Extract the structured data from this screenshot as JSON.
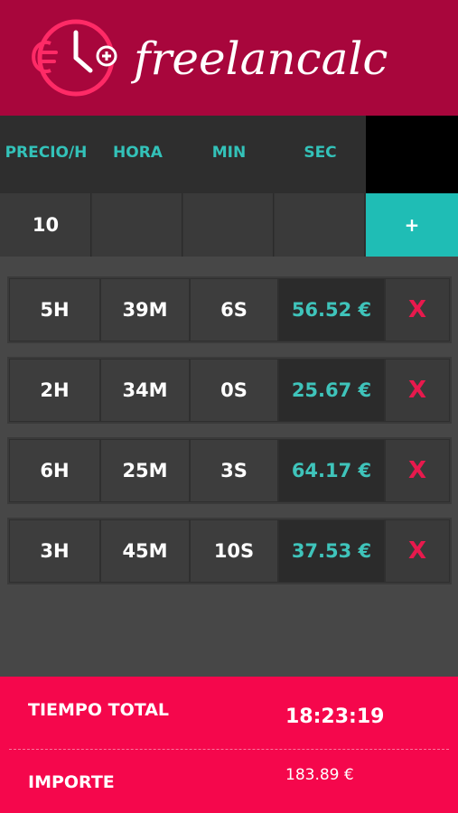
{
  "brand": {
    "name": "freelancalc",
    "color": "#a8063c"
  },
  "columns": [
    "PRECIO/H",
    "HORA",
    "MIN",
    "SEC"
  ],
  "input": {
    "price": "10",
    "hour": "",
    "min": "",
    "sec": "",
    "add_label": "+"
  },
  "entries": [
    {
      "hours": "5H",
      "minutes": "39M",
      "seconds": "6S",
      "amount": "56.52 €",
      "delete": "X"
    },
    {
      "hours": "2H",
      "minutes": "34M",
      "seconds": "0S",
      "amount": "25.67 €",
      "delete": "X"
    },
    {
      "hours": "6H",
      "minutes": "25M",
      "seconds": "3S",
      "amount": "64.17 €",
      "delete": "X"
    },
    {
      "hours": "3H",
      "minutes": "45M",
      "seconds": "10S",
      "amount": "37.53 €",
      "delete": "X"
    }
  ],
  "footer": {
    "total_time_label": "TIEMPO TOTAL",
    "total_time_value": "18:23:19",
    "amount_label": "IMPORTE",
    "amount_value": "183.89 €"
  },
  "colors": {
    "accent": "#1fbdb5",
    "footer": "#f5074c",
    "delete": "#e8194d"
  }
}
